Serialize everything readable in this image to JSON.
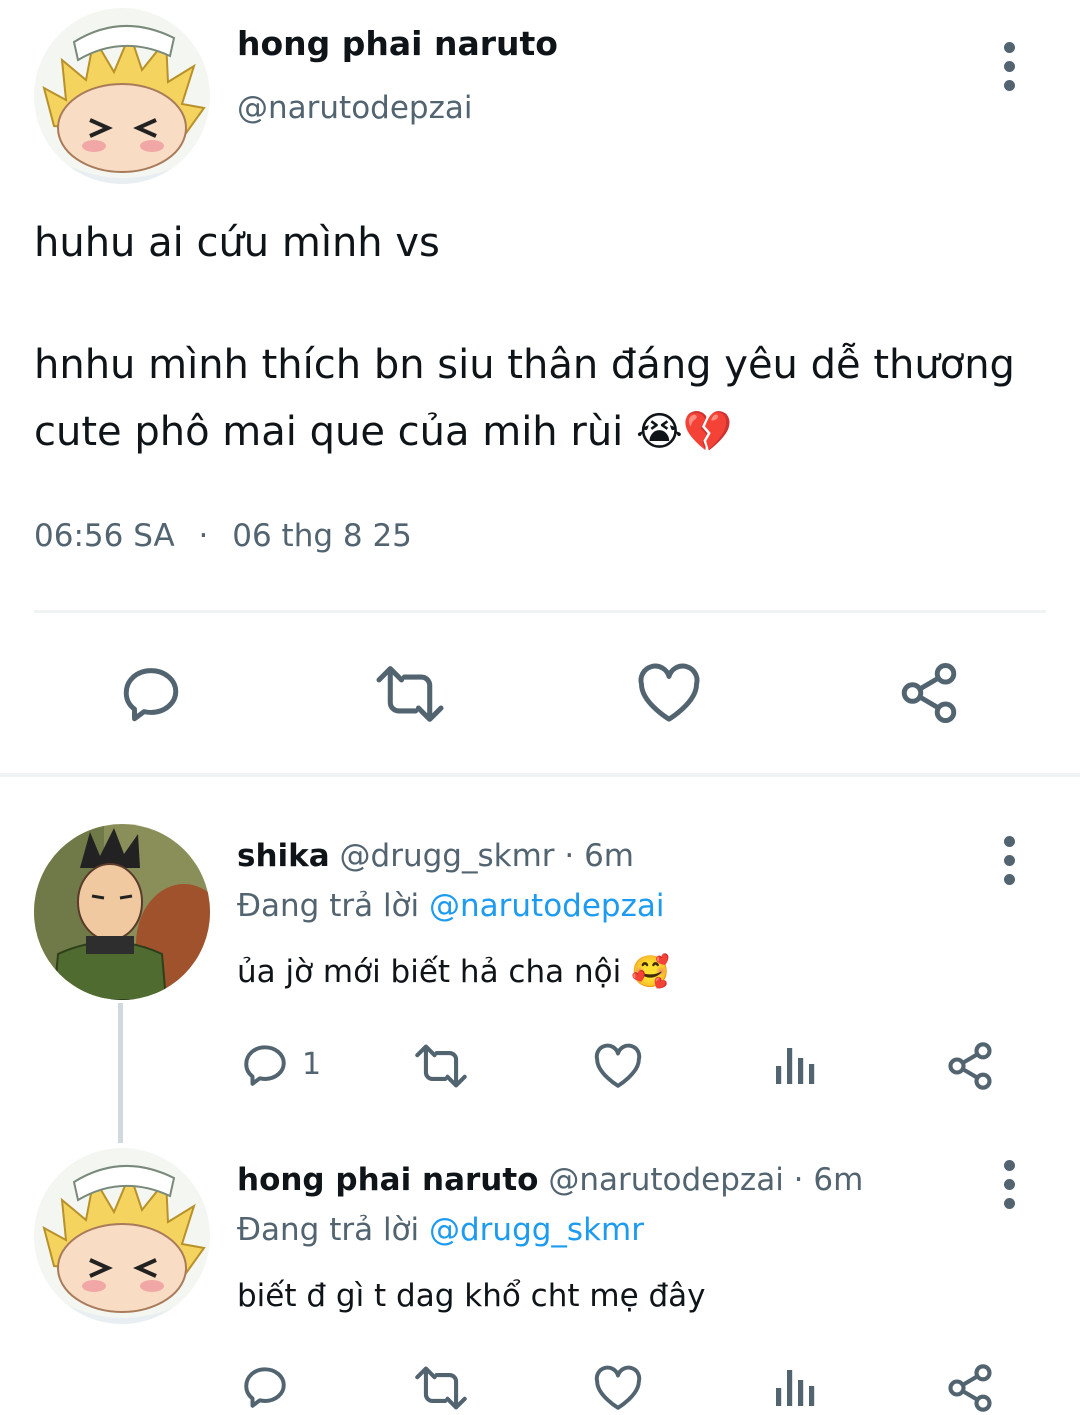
{
  "main_tweet": {
    "display_name": "hong phai naruto",
    "handle": "@narutodepzai",
    "text_line1": "huhu ai cứu mình vs",
    "text_line2": "hnhu mình thích bn siu thân đáng yêu dễ thương",
    "text_line3": "cute phô mai que của mih rùi",
    "emoji": "😭💔",
    "time": "06:56 SA",
    "separator": "·",
    "date": "06 thg 8 25"
  },
  "reply1": {
    "display_name": "shika",
    "handle_time": "@drugg_skmr · 6m",
    "replying_prefix": "Đang trả lời",
    "replying_to": "@narutodepzai",
    "text": "ủa jờ mới biết hả cha nội",
    "emoji": "🥰",
    "reply_count": "1"
  },
  "reply2": {
    "display_name": "hong phai naruto",
    "handle_time": "@narutodepzai · 6m",
    "replying_prefix": "Đang trả lời",
    "replying_to": "@drugg_skmr",
    "text": "biết đ gì t dag khổ cht mẹ đây"
  },
  "icons": [
    "more-icon",
    "reply-icon",
    "retweet-icon",
    "like-icon",
    "share-icon",
    "views-icon"
  ],
  "colors": {
    "text": "#0f1419",
    "muted": "#536471",
    "link": "#1d9bf0",
    "divider": "#eff3f4"
  }
}
